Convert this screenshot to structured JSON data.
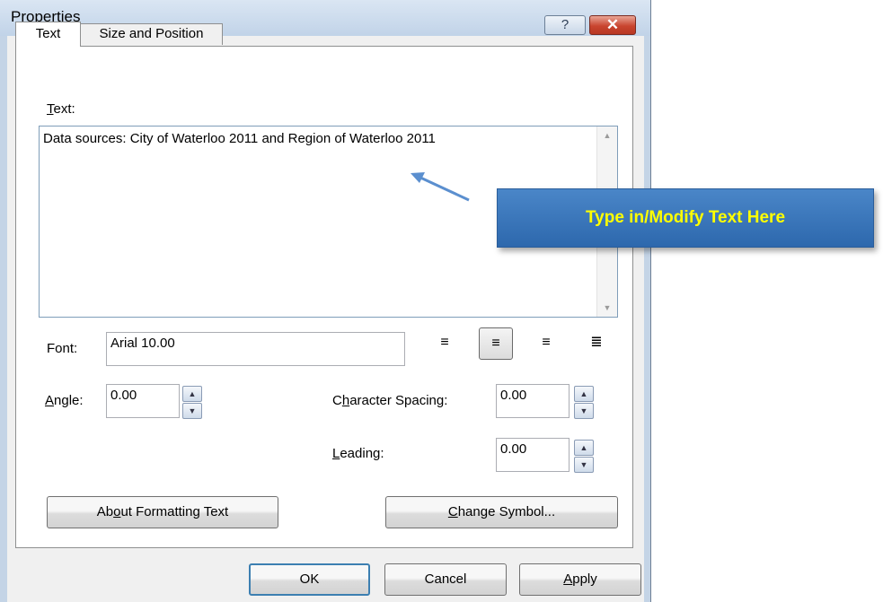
{
  "window": {
    "title": "Properties",
    "help_label": "?",
    "close_label": "✕"
  },
  "tabs": [
    {
      "label": "Text"
    },
    {
      "label": "Size and Position"
    }
  ],
  "text_section": {
    "label_key": "T",
    "label_rest": "ext:",
    "value": "Data sources: City of Waterloo 2011 and Region of Waterloo 2011"
  },
  "font": {
    "label": "Font:",
    "value": "Arial 10.00"
  },
  "alignment": {
    "options": [
      "left",
      "center",
      "right",
      "justify"
    ],
    "selected": "center"
  },
  "angle": {
    "label_key": "A",
    "label_rest": "ngle:",
    "value": "0.00"
  },
  "character_spacing": {
    "label_pre": "C",
    "label_key": "h",
    "label_rest": "aracter Spacing:",
    "value": "0.00"
  },
  "leading": {
    "label_key": "L",
    "label_rest": "eading:",
    "value": "0.00"
  },
  "buttons": {
    "about_pre": "Ab",
    "about_key": "o",
    "about_rest": "ut Formatting Text",
    "change_key": "C",
    "change_rest": "hange Symbol...",
    "ok": "OK",
    "cancel": "Cancel",
    "apply_key": "A",
    "apply_rest": "pply"
  },
  "callout": {
    "text": "Type in/Modify Text Here"
  },
  "colors": {
    "callout_bg": "#2d68ad",
    "callout_text": "#ffff00",
    "arrow": "#5b8fcf"
  }
}
